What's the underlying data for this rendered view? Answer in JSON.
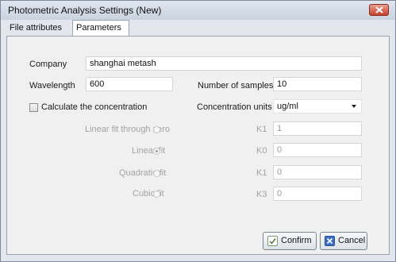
{
  "window": {
    "title": "Photometric Analysis Settings (New)"
  },
  "tabs": [
    {
      "label": "File attributes"
    },
    {
      "label": "Parameters"
    }
  ],
  "form": {
    "company_label": "Company",
    "company_value": "shanghai metash",
    "wavelength_label": "Wavelength",
    "wavelength_value": "600",
    "samples_label": "Number of samples",
    "samples_value": "10",
    "calc_label": "Calculate the concentration",
    "calc_checked": false,
    "units_label": "Concentration units",
    "units_value": "ug/ml",
    "fits": [
      {
        "label": "Linear fit through zero",
        "selected": false,
        "coef_label": "K1",
        "coef_value": "1"
      },
      {
        "label": "Linear fit",
        "selected": true,
        "coef_label": "K0",
        "coef_value": "0"
      },
      {
        "label": "Quadratic fit",
        "selected": false,
        "coef_label": "K1",
        "coef_value": "0"
      },
      {
        "label": "Cubic fit",
        "selected": false,
        "coef_label": "K3",
        "coef_value": "0"
      }
    ]
  },
  "buttons": {
    "confirm_label": "Confirm",
    "cancel_label": "Cancel"
  },
  "colors": {
    "cancel_icon": "#3b6fc2",
    "confirm_icon": "#7d9a6e",
    "close_button": "#c6402a"
  }
}
